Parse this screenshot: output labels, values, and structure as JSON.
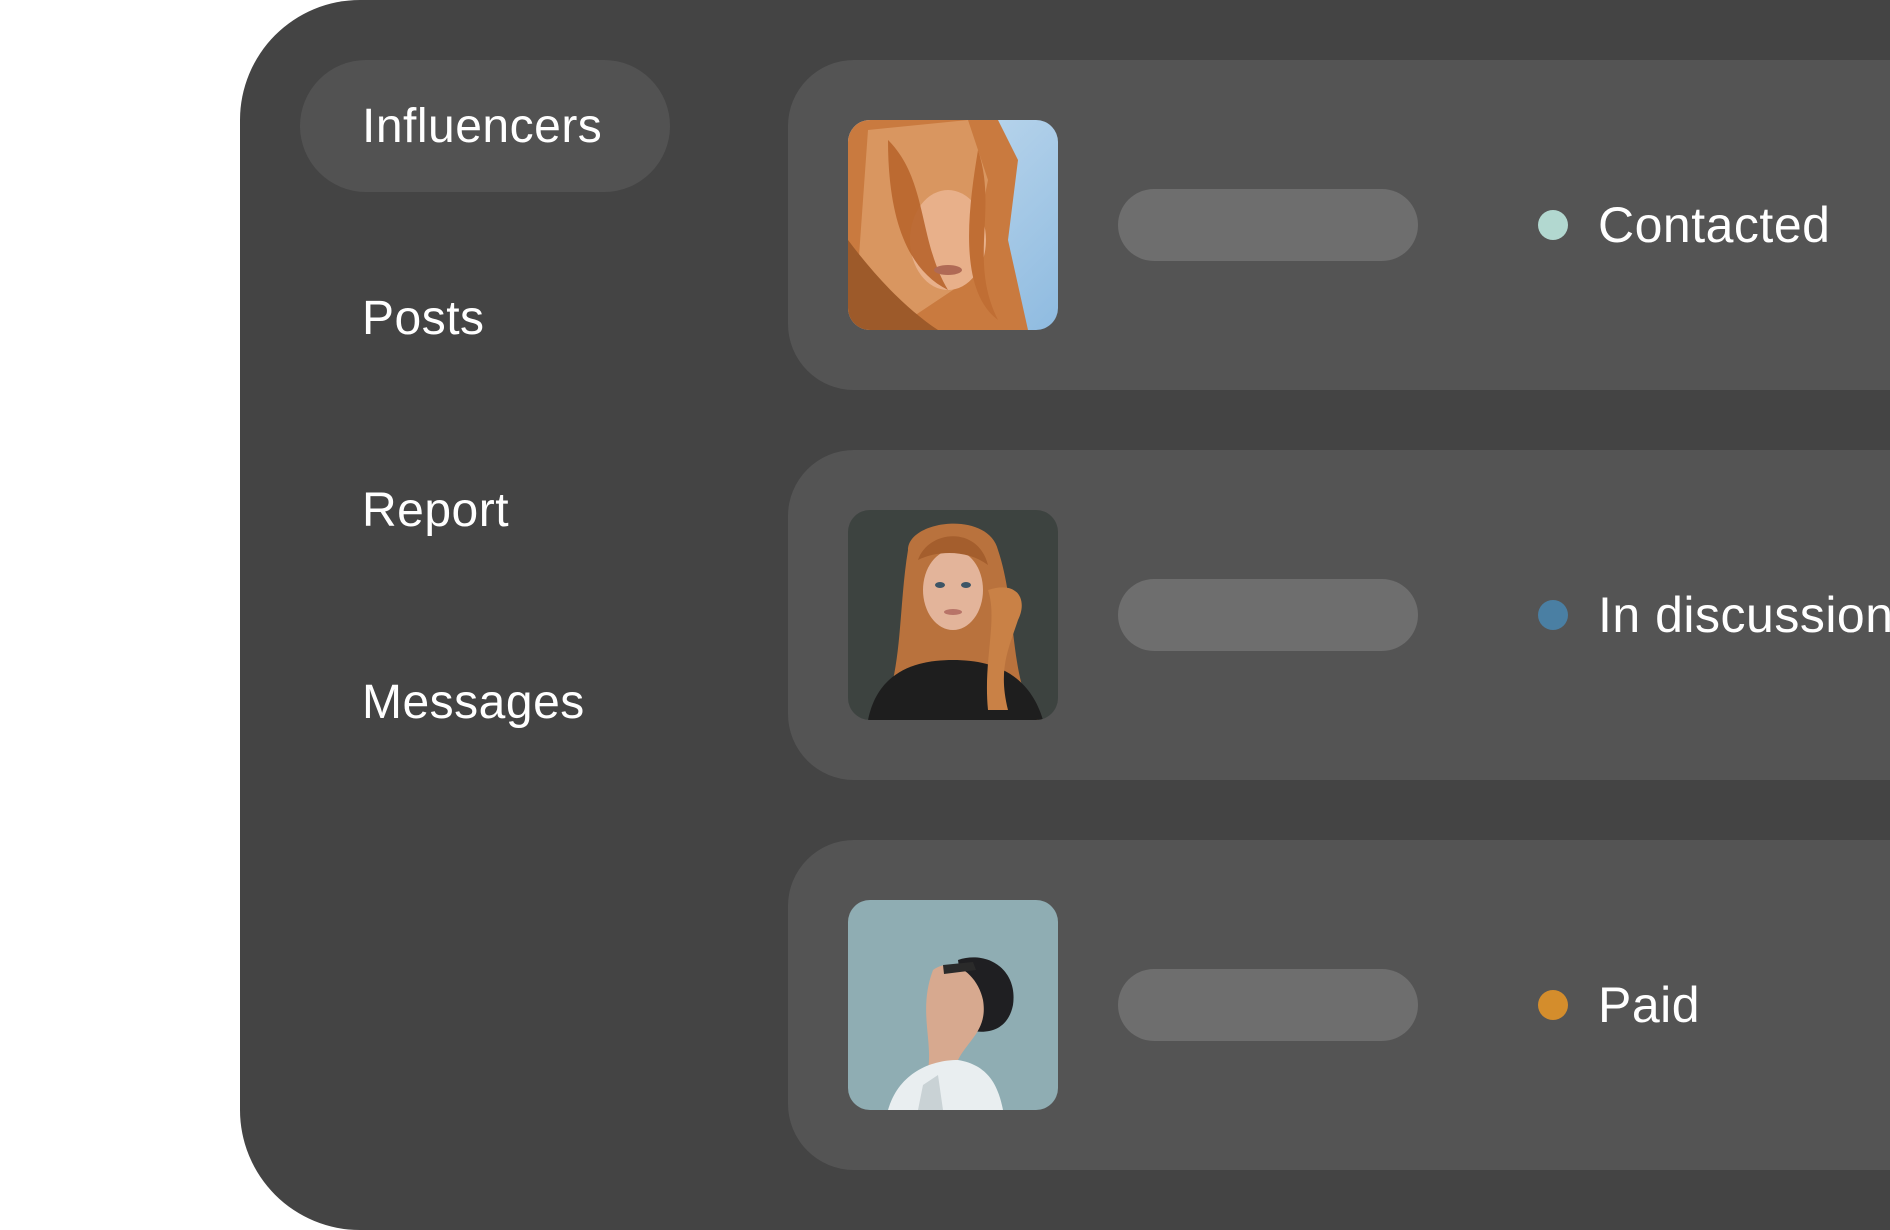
{
  "sidebar": {
    "items": [
      {
        "label": "Influencers",
        "active": true
      },
      {
        "label": "Posts",
        "active": false
      },
      {
        "label": "Report",
        "active": false
      },
      {
        "label": "Messages",
        "active": false
      }
    ]
  },
  "influencers": [
    {
      "avatar": "woman-red-hair-windblown-photo",
      "status": "Contacted",
      "status_color": "#b2d8d0"
    },
    {
      "avatar": "woman-long-red-hair-portrait-photo",
      "status": "In discussion",
      "status_color": "#4a7fa3"
    },
    {
      "avatar": "man-profile-looking-up-photo",
      "status": "Paid",
      "status_color": "#d48d2c"
    }
  ],
  "colors": {
    "window_bg": "#444444",
    "row_bg": "#545454",
    "active_nav_bg": "#525252",
    "placeholder": "#6e6e6e",
    "text": "#ffffff"
  }
}
